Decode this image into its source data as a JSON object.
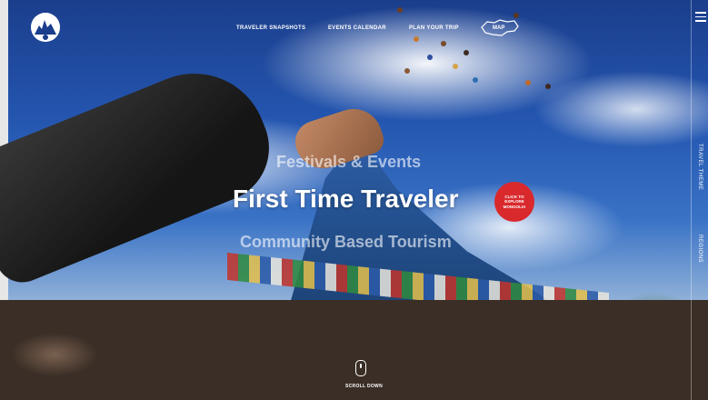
{
  "nav": {
    "logo_icon": "mongolia-logo-icon",
    "links": [
      {
        "label": "TRAVELER SNAPSHOTS"
      },
      {
        "label": "EVENTS CALENDAR"
      },
      {
        "label": "PLAN YOUR TRIP"
      }
    ],
    "map_label": "MAP",
    "menu_icon": "hamburger-icon"
  },
  "side": {
    "travel_themes": "TRAVEL THEME",
    "regions": "REGIONS"
  },
  "hero": {
    "headline_1": "Festivals & Events",
    "headline_2": "First Time Traveler",
    "headline_3": "Community Based Tourism",
    "cta_line1": "CLICK TO",
    "cta_line2": "EXPLORE",
    "cta_line3": "MONGOLIA"
  },
  "scroll": {
    "label": "SCROLL DOWN",
    "icon": "mouse-scroll-icon"
  },
  "colors": {
    "accent": "#d9292d",
    "sky": "#2456b0"
  }
}
